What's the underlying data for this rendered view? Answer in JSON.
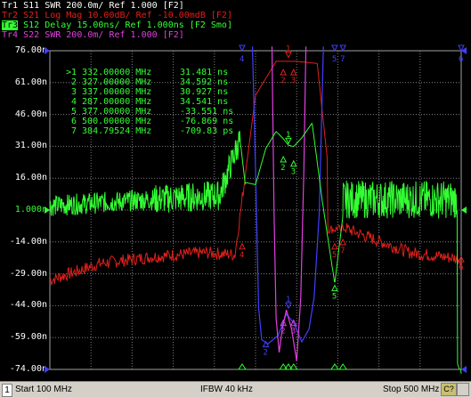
{
  "traces": [
    {
      "id": "Tr1",
      "param": "S11",
      "fmt": "SWR",
      "scale": "200.0m/",
      "ref": "Ref 1.000",
      "ch": "[F2]",
      "color": "#ffffff",
      "active": false
    },
    {
      "id": "Tr2",
      "param": "S21",
      "fmt": "Log Mag",
      "scale": "10.00dB/",
      "ref": "Ref -10.00mdB",
      "ch": "[F2]",
      "color": "#e0201a",
      "active": false
    },
    {
      "id": "Tr3",
      "param": "S12",
      "fmt": "Delay",
      "scale": "15.00ns/",
      "ref": "Ref 1.000ns",
      "ch": "[F2 Smo]",
      "color": "#33ff33",
      "active": true
    },
    {
      "id": "Tr4",
      "param": "S22",
      "fmt": "SWR",
      "scale": "200.0m/",
      "ref": "Ref 1.000",
      "ch": "[F2]",
      "color": "#e040e0",
      "active": false
    }
  ],
  "y_ticks": [
    "76.00n",
    "61.00n",
    "46.00n",
    "31.00n",
    "16.00n",
    "1.000n",
    "-14.00n",
    "-29.00n",
    "-44.00n",
    "-59.00n",
    "-74.00n"
  ],
  "marker_table": [
    {
      "id": ">1",
      "freq": "332.00000 MHz",
      "value": "31.481 ns"
    },
    {
      "id": "2",
      "freq": "327.00000 MHz",
      "value": "34.592 ns"
    },
    {
      "id": "3",
      "freq": "337.00000 MHz",
      "value": "30.927 ns"
    },
    {
      "id": "4",
      "freq": "287.00000 MHz",
      "value": "34.541 ns"
    },
    {
      "id": "5",
      "freq": "377.00000 MHz",
      "value": "-33.551 ns"
    },
    {
      "id": "6",
      "freq": "500.00000 MHz",
      "value": "-76.869 ns"
    },
    {
      "id": "7",
      "freq": "384.79524 MHz",
      "value": "-709.83 ps"
    }
  ],
  "status": {
    "channel": "1",
    "start": "Start 100 MHz",
    "ifbw": "IFBW 40 kHz",
    "stop": "Stop 500 MHz",
    "c_button": "C?"
  },
  "colors": {
    "grid": "#808080",
    "tr1": "#4040ff",
    "tr2": "#e0201a",
    "tr3": "#33ff33",
    "tr4": "#e040e0",
    "ref_marker": "#33ff33"
  },
  "chart_data": {
    "type": "line",
    "x_range_mhz": [
      100,
      500
    ],
    "ylim": [
      -74,
      76
    ],
    "y_unit": "ns",
    "grid": true,
    "series": [
      {
        "name": "S12 Delay",
        "note": "noisy ~1.000ns baseline, peaks near 287 MHz and 377 MHz",
        "x": [
          100,
          150,
          200,
          250,
          270,
          285,
          290,
          300,
          320,
          327,
          332,
          337,
          350,
          370,
          377,
          385,
          400,
          450,
          500
        ],
        "y": [
          1,
          3,
          5,
          7,
          10,
          34,
          13,
          12,
          30,
          34.6,
          31.5,
          30.9,
          36,
          -10,
          -33.6,
          -0.7,
          1,
          3,
          -76.9
        ]
      },
      {
        "name": "S21 Log Mag",
        "note": "bandpass ~300-375 MHz",
        "x": [
          100,
          150,
          200,
          250,
          280,
          300,
          320,
          340,
          360,
          377,
          385,
          400,
          450,
          500
        ],
        "y": [
          -32,
          -24,
          -21,
          -19,
          -20,
          55,
          71,
          71,
          70,
          -8,
          -7,
          -10,
          -19,
          -22
        ]
      }
    ]
  }
}
